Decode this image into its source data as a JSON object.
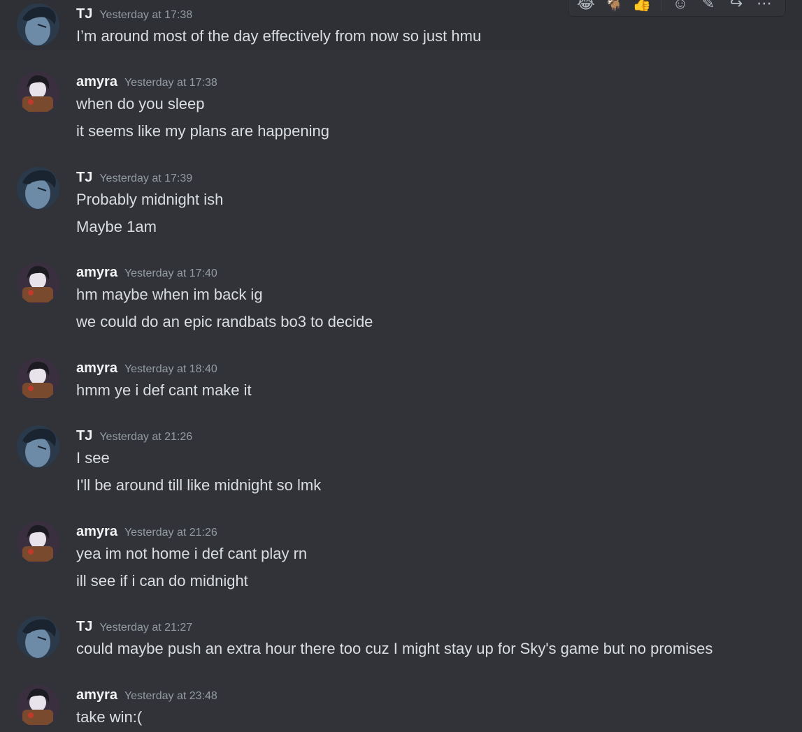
{
  "colors": {
    "background": "#313338",
    "text": "#dbdee1",
    "timestamp": "#949ba4",
    "author": "#f2f3f5"
  },
  "toolbar": {
    "icons": [
      "joy-emoji-icon",
      "goat-emoji-icon",
      "thumbs-up-emoji-icon",
      "add-reaction-icon",
      "edit-icon",
      "reply-icon",
      "more-icon"
    ]
  },
  "messages": [
    {
      "author": "TJ",
      "timestamp": "Yesterday at 17:38",
      "lines": [
        "I’m around most of the day effectively from now so just hmu"
      ]
    },
    {
      "author": "amyra",
      "timestamp": "Yesterday at 17:38",
      "lines": [
        "when do you sleep",
        "it seems like my plans are happening"
      ]
    },
    {
      "author": "TJ",
      "timestamp": "Yesterday at 17:39",
      "lines": [
        "Probably midnight ish",
        "Maybe 1am"
      ]
    },
    {
      "author": "amyra",
      "timestamp": "Yesterday at 17:40",
      "lines": [
        "hm  maybe when im back ig",
        "we could do an epic randbats bo3  to decide"
      ]
    },
    {
      "author": "amyra",
      "timestamp": "Yesterday at 18:40",
      "lines": [
        "hmm ye i def cant make it"
      ]
    },
    {
      "author": "TJ",
      "timestamp": "Yesterday at 21:26",
      "lines": [
        "I see",
        "I'll be around till like midnight so lmk"
      ]
    },
    {
      "author": "amyra",
      "timestamp": "Yesterday at 21:26",
      "lines": [
        "yea im not home i def cant play rn",
        "ill see if i can do midnight"
      ]
    },
    {
      "author": "TJ",
      "timestamp": "Yesterday at 21:27",
      "lines": [
        "could maybe push an extra hour there too cuz I might stay up for Sky's game but no promises"
      ]
    },
    {
      "author": "amyra",
      "timestamp": "Yesterday at 23:48",
      "lines": [
        "take win:("
      ]
    }
  ]
}
